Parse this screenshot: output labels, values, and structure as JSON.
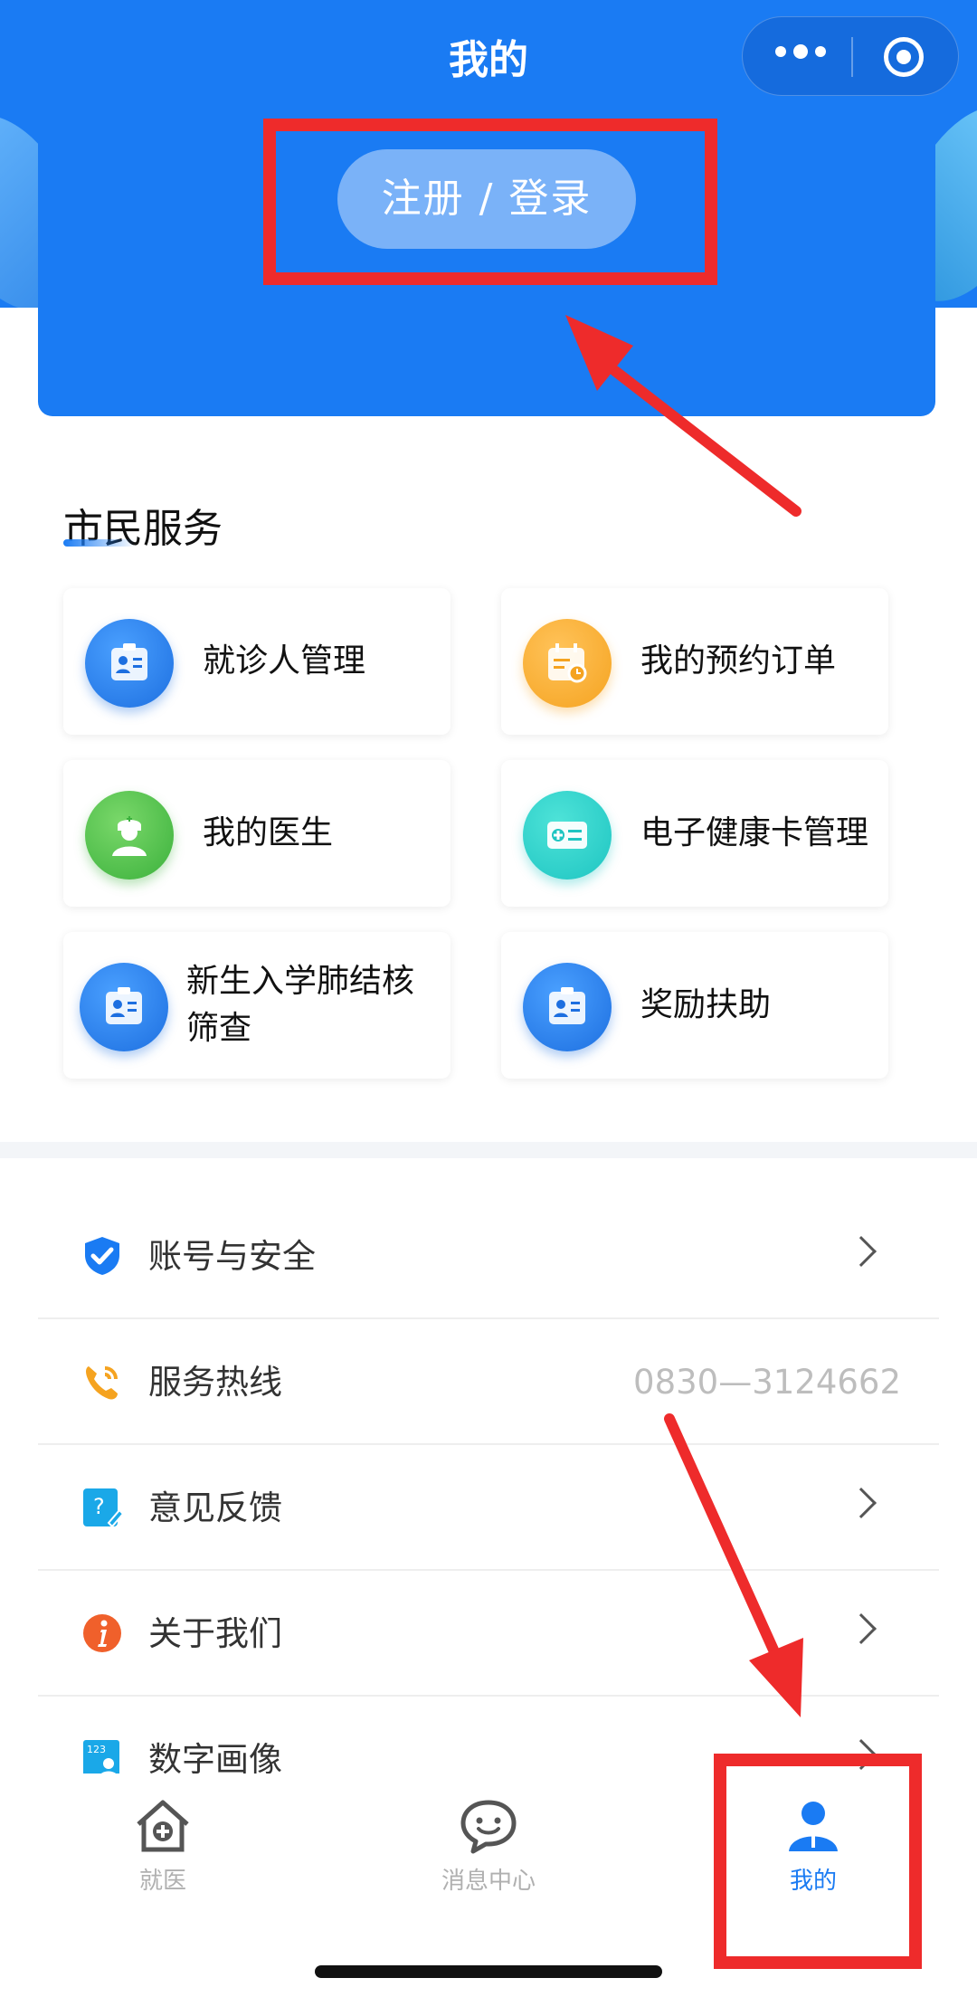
{
  "header": {
    "title": "我的",
    "login_label": "注册 / 登录"
  },
  "section": {
    "title": "市民服务",
    "cards": [
      {
        "label": "就诊人管理",
        "icon": "patient-card-icon",
        "color": "#1d6fe0"
      },
      {
        "label": "我的预约订单",
        "icon": "calendar-clock-icon",
        "color": "#f5a320"
      },
      {
        "label": "我的医生",
        "icon": "doctor-icon",
        "color": "#3bb13c"
      },
      {
        "label": "电子健康卡管理",
        "icon": "health-card-icon",
        "color": "#1ec5c2"
      },
      {
        "label": "新生入学肺结核筛查",
        "icon": "patient-card-icon",
        "color": "#1d6fe0"
      },
      {
        "label": "奖励扶助",
        "icon": "patient-card-icon",
        "color": "#1d6fe0"
      }
    ]
  },
  "list": [
    {
      "label": "账号与安全",
      "icon": "shield-check-icon",
      "value": ""
    },
    {
      "label": "服务热线",
      "icon": "phone-icon",
      "value": "0830—3124662"
    },
    {
      "label": "意见反馈",
      "icon": "feedback-icon",
      "value": ""
    },
    {
      "label": "关于我们",
      "icon": "info-icon",
      "value": ""
    },
    {
      "label": "数字画像",
      "icon": "digital-profile-icon",
      "value": ""
    }
  ],
  "tabbar": [
    {
      "label": "就医",
      "icon": "hospital-home-icon",
      "active": false
    },
    {
      "label": "消息中心",
      "icon": "chat-bubble-icon",
      "active": false
    },
    {
      "label": "我的",
      "icon": "user-icon",
      "active": true
    }
  ],
  "colors": {
    "primary": "#1a7bf3",
    "annotation": "#ee2b2b"
  }
}
